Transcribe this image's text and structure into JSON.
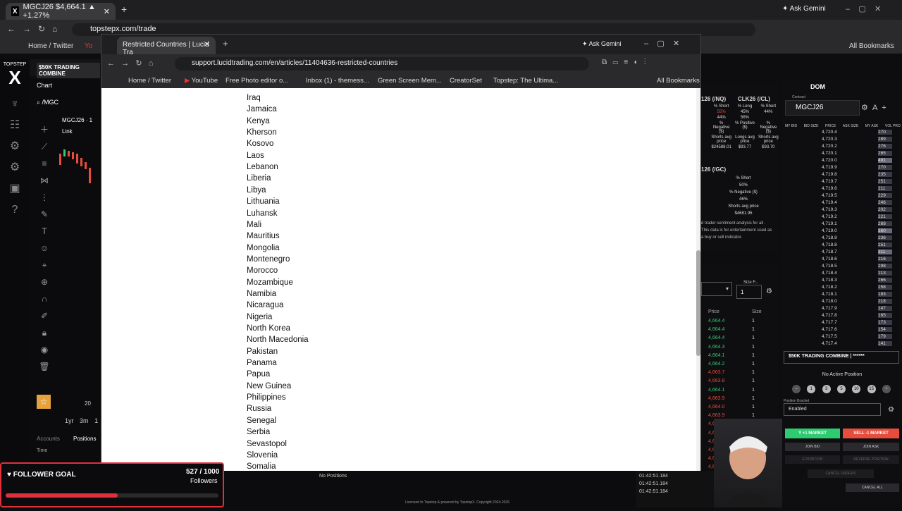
{
  "outer_browser": {
    "tab_title": "MGCJ26 $4,664.1 ▲ +1.27%",
    "ask_gemini": "Ask Gemini",
    "url": "topstepx.com/trade",
    "bookmarks": [
      "Home / Twitter",
      "Yo"
    ],
    "all_bookmarks": "All Bookmarks"
  },
  "topstep": {
    "logo": "TOPSTEP",
    "account_label": "$50K TRADING COMBINE",
    "chart_tab": "Chart",
    "symbol_search": "/MGC",
    "chart_symbol": "MGCJ26 · 1",
    "link_label": "Link",
    "timeframes": [
      "1yr",
      "3m",
      "1"
    ],
    "axis_value": "20",
    "bottom_tabs": [
      "Accounts",
      "Positions"
    ],
    "time_header": "Time",
    "no_positions": "No Positions",
    "license": "Licensed to Topstep & powered by TopstepX. Copyright 2024-2026",
    "refresh_rate": "Refresh Rate: Medium",
    "layout": "LAYOUT | default (draft)"
  },
  "inner_browser": {
    "tab_title": "Restricted Countries | Lucid Tra",
    "ask_gemini": "Ask Gemini",
    "url": "support.lucidtrading.com/en/articles/11404636-restricted-countries",
    "bookmarks": [
      "Home / Twitter",
      "YouTube",
      "Free Photo editor o...",
      "Inbox (1) - themess...",
      "Green Screen Mem...",
      "CreatorSet",
      "Topstep: The Ultima..."
    ],
    "all_bookmarks": "All Bookmarks"
  },
  "countries": [
    "Iraq",
    "Jamaica",
    "Kenya",
    "Kherson",
    "Kosovo",
    "Laos",
    "Lebanon",
    "Liberia",
    "Libya",
    "Lithuania",
    "Luhansk",
    "Mali",
    "Mauritius",
    "Mongolia",
    "Montenegro",
    "Morocco",
    "Mozambique",
    "Namibia",
    "Nicaragua",
    "Nigeria",
    "North Korea",
    "North Macedonia",
    "Pakistan",
    "Panama",
    "Papua",
    "New Guinea",
    "Philippines",
    "Russia",
    "Senegal",
    "Serbia",
    "Sevastopol",
    "Slovenia",
    "Somalia"
  ],
  "sentiment": {
    "nq_header": "126 (/NQ)",
    "cl_header": "CLK26 (/CL)",
    "lines": [
      "% Short",
      "% Long",
      "% Short",
      "55%",
      "45%",
      "44%",
      "44%",
      "56%",
      "% Negative ($)",
      "% Positive ($)",
      "% Negative ($)",
      "Shorts avg price",
      "Longs avg price",
      "Shorts avg price",
      "$24588.01",
      "$93.77",
      "$93.70"
    ],
    "gc_header": "126 (/GC)",
    "gc_short": "% Short",
    "gc_pct": "50%",
    "gc_neg": "% Negative ($)",
    "gc_negval": "46%",
    "gc_avg": "Shorts avg price",
    "gc_price": "$4681.95",
    "disclaimer": "d trader sentiment analysis for all . This data is for entertainment used as a buy or sell indicator."
  },
  "orders": {
    "size_label": "Size F...",
    "size_value": "1",
    "price_header": "Price",
    "size_header": "Size",
    "rows": [
      {
        "p": "4,664.4",
        "s": "1",
        "c": "green"
      },
      {
        "p": "4,664.4",
        "s": "1",
        "c": "green"
      },
      {
        "p": "4,664.4",
        "s": "1",
        "c": "green"
      },
      {
        "p": "4,664.3",
        "s": "1",
        "c": "green"
      },
      {
        "p": "4,664.1",
        "s": "1",
        "c": "green"
      },
      {
        "p": "4,664.2",
        "s": "1",
        "c": "green"
      },
      {
        "p": "4,663.7",
        "s": "1",
        "c": "red"
      },
      {
        "p": "4,663.8",
        "s": "1",
        "c": "red"
      },
      {
        "p": "4,664.1",
        "s": "1",
        "c": "green"
      },
      {
        "p": "4,663.9",
        "s": "1",
        "c": "red"
      },
      {
        "p": "4,664.0",
        "s": "1",
        "c": "red"
      },
      {
        "p": "4,663.9",
        "s": "1",
        "c": "red"
      },
      {
        "p": "4,663.9",
        "s": "1",
        "c": "red"
      },
      {
        "p": "4,663.8",
        "s": "1",
        "c": "red"
      },
      {
        "p": "4,664.2",
        "s": "1",
        "c": "red"
      },
      {
        "p": "4,663.9",
        "s": "1",
        "c": "red"
      },
      {
        "p": "4,663.8",
        "s": "1",
        "c": "red"
      },
      {
        "p": "4,663.6",
        "s": "1",
        "c": "red"
      }
    ]
  },
  "times": [
    "01:42:51.184",
    "01:42:51.184",
    "01:42:51.184"
  ],
  "dom": {
    "title": "DOM",
    "contract_label": "Contract",
    "contract": "MGCJ26",
    "headers": [
      "MY BID",
      "BID SIZE",
      "PRICE",
      "ASK SIZE",
      "MY ASK",
      "VOL PRO"
    ],
    "rows": [
      [
        "4,720.4",
        "270"
      ],
      [
        "4,720.3",
        "289"
      ],
      [
        "4,720.2",
        "276"
      ],
      [
        "4,720.1",
        "265"
      ],
      [
        "4,720.0",
        "481"
      ],
      [
        "4,719.9",
        "270"
      ],
      [
        "4,719.8",
        "235"
      ],
      [
        "4,719.7",
        "251"
      ],
      [
        "4,719.6",
        "211"
      ],
      [
        "4,719.5",
        "229"
      ],
      [
        "4,719.4",
        "246"
      ],
      [
        "4,719.3",
        "202"
      ],
      [
        "4,719.2",
        "221"
      ],
      [
        "4,719.1",
        "268"
      ],
      [
        "4,719.0",
        "360"
      ],
      [
        "4,718.9",
        "236"
      ],
      [
        "4,718.8",
        "251"
      ],
      [
        "4,718.7",
        "311"
      ],
      [
        "4,718.6",
        "216"
      ],
      [
        "4,718.5",
        "298"
      ],
      [
        "4,718.4",
        "213"
      ],
      [
        "4,718.3",
        "266"
      ],
      [
        "4,718.2",
        "258"
      ],
      [
        "4,718.1",
        "183"
      ],
      [
        "4,718.0",
        "218"
      ],
      [
        "4,717.9",
        "147"
      ],
      [
        "4,717.8",
        "165"
      ],
      [
        "4,717.7",
        "173"
      ],
      [
        "4,717.6",
        "154"
      ],
      [
        "4,717.5",
        "179"
      ],
      [
        "4,717.4",
        "141"
      ]
    ]
  },
  "order_panel": {
    "account": "$50K TRADING COMBINE | ******",
    "no_position": "No Active Position",
    "qty": [
      "1",
      "3",
      "5",
      "10",
      "15"
    ],
    "bracket_label": "Position Bracket",
    "bracket_value": "Enabled",
    "buy": "Y +1 MARKET",
    "sell": "SELL -1 MARKET",
    "join_bid": "JOIN BID",
    "join_ask": "JOIN ASK",
    "e_position": "E POSITION",
    "reverse": "REVERSE POSITION",
    "cancel_orders": "CANCEL ORDERS",
    "cancel_all": "CANCEL ALL"
  },
  "goal": {
    "title": "FOLLOWER GOAL",
    "count": "527 / 1000",
    "unit": "Followers",
    "progress": 0.527
  }
}
